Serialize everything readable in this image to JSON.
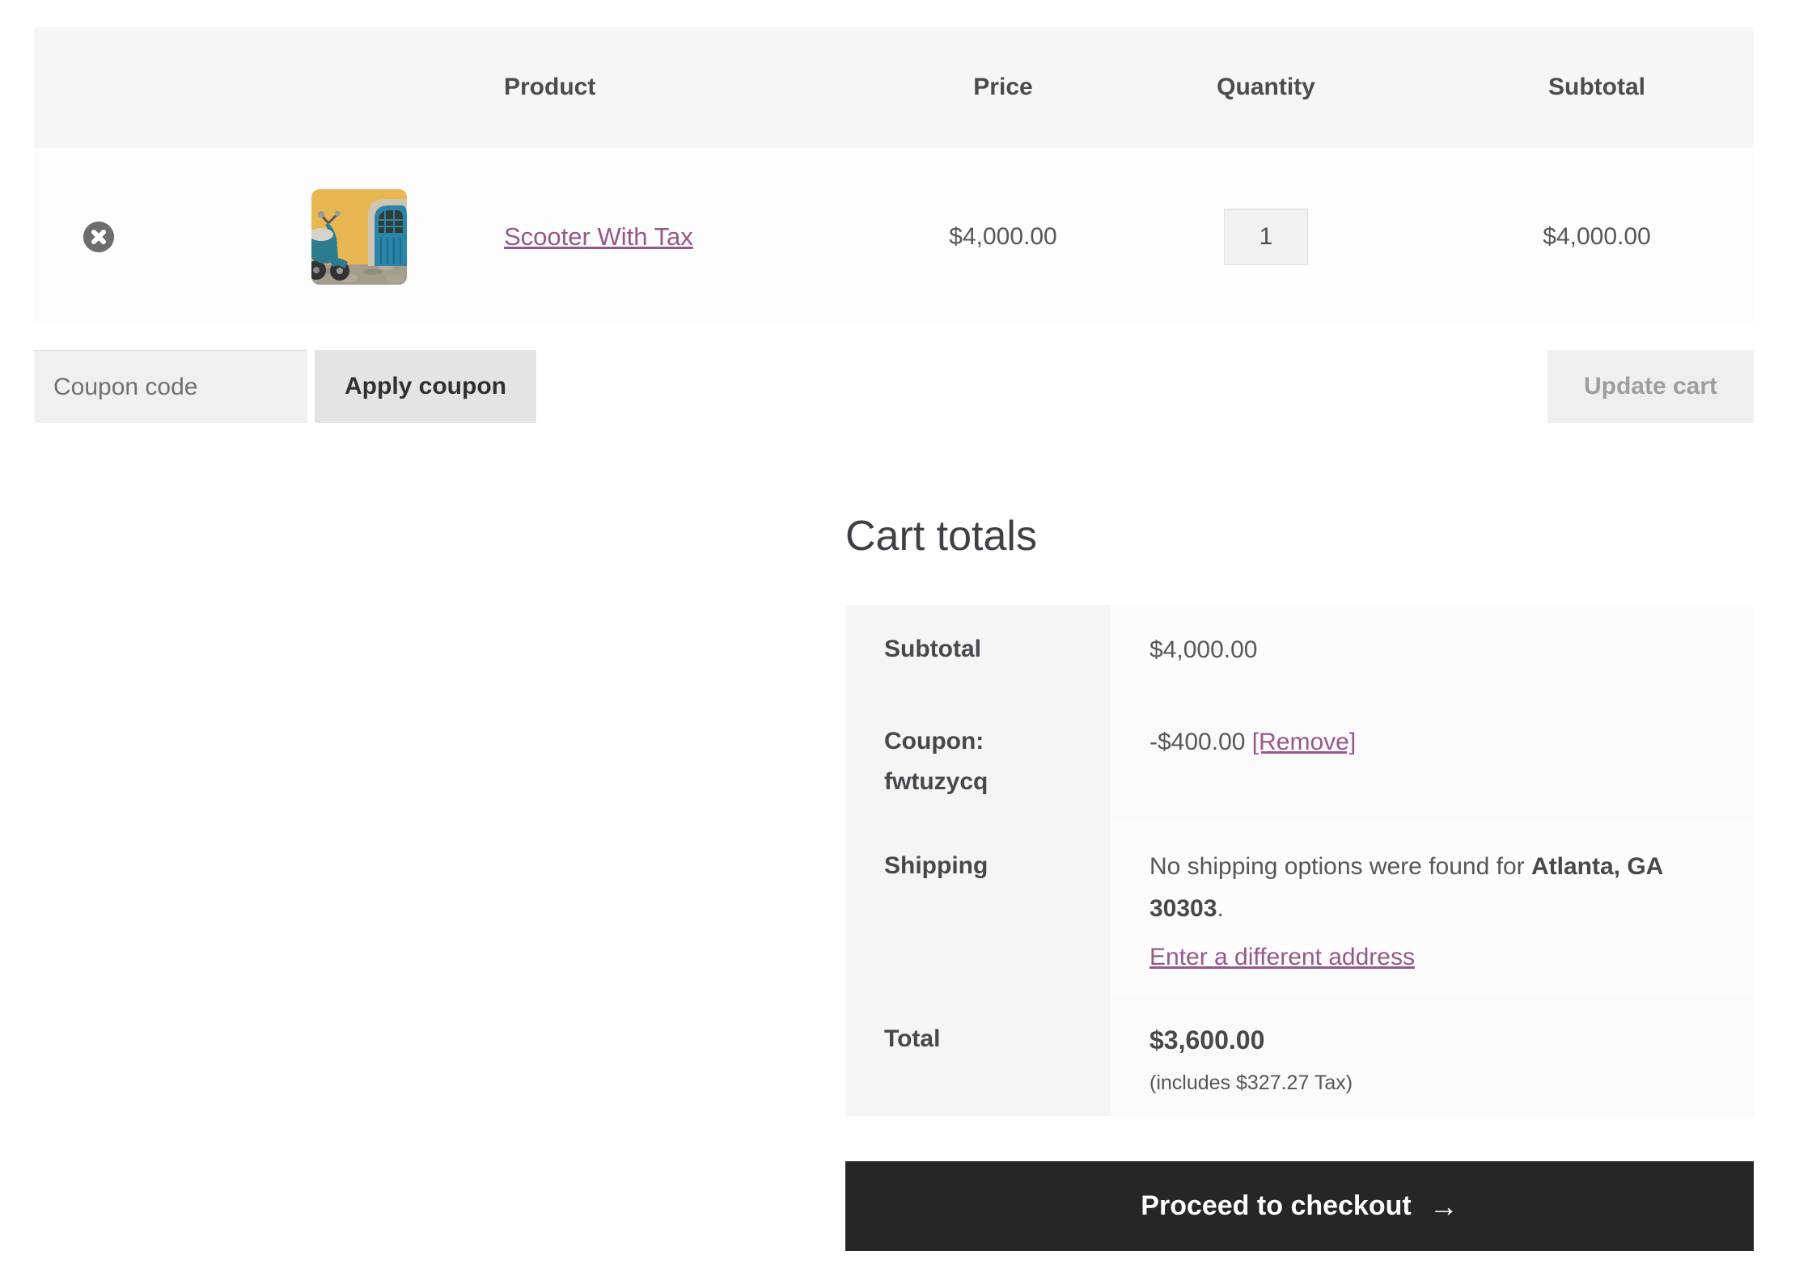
{
  "cart_table": {
    "headers": {
      "product": "Product",
      "price": "Price",
      "quantity": "Quantity",
      "subtotal": "Subtotal"
    },
    "items": [
      {
        "name": "Scooter With Tax",
        "price": "$4,000.00",
        "quantity": "1",
        "subtotal": "$4,000.00",
        "image": "teal-scooter-by-yellow-wall-with-blue-door"
      }
    ]
  },
  "coupon": {
    "placeholder": "Coupon code",
    "apply_label": "Apply coupon",
    "update_cart_label": "Update cart"
  },
  "cart_totals": {
    "title": "Cart totals",
    "rows": {
      "subtotal": {
        "label": "Subtotal",
        "value": "$4,000.00"
      },
      "coupon": {
        "label_line1": "Coupon:",
        "label_line2": "fwtuzycq",
        "amount": "-$400.00 ",
        "remove_link": "[Remove]"
      },
      "shipping": {
        "label": "Shipping",
        "message_prefix": "No shipping options were found for ",
        "destination": "Atlanta, GA 30303",
        "message_suffix": ".",
        "link": "Enter a different address"
      },
      "total": {
        "label": "Total",
        "value": "$3,600.00",
        "tax_note": "(includes $327.27 Tax)"
      }
    },
    "checkout_button": "Proceed to checkout",
    "checkout_arrow": "→"
  },
  "icons": {
    "remove": "circle-x",
    "checkout_arrow": "right-arrow"
  },
  "colors": {
    "accent": "#96588a",
    "dark_button": "#262626",
    "header_bg": "#f6f6f6",
    "row_bg": "#fdfdfd",
    "label_bg": "#f5f5f5",
    "control_bg": "#f1f0f0",
    "apply_bg": "#e5e4e4",
    "text": "#47494e"
  }
}
